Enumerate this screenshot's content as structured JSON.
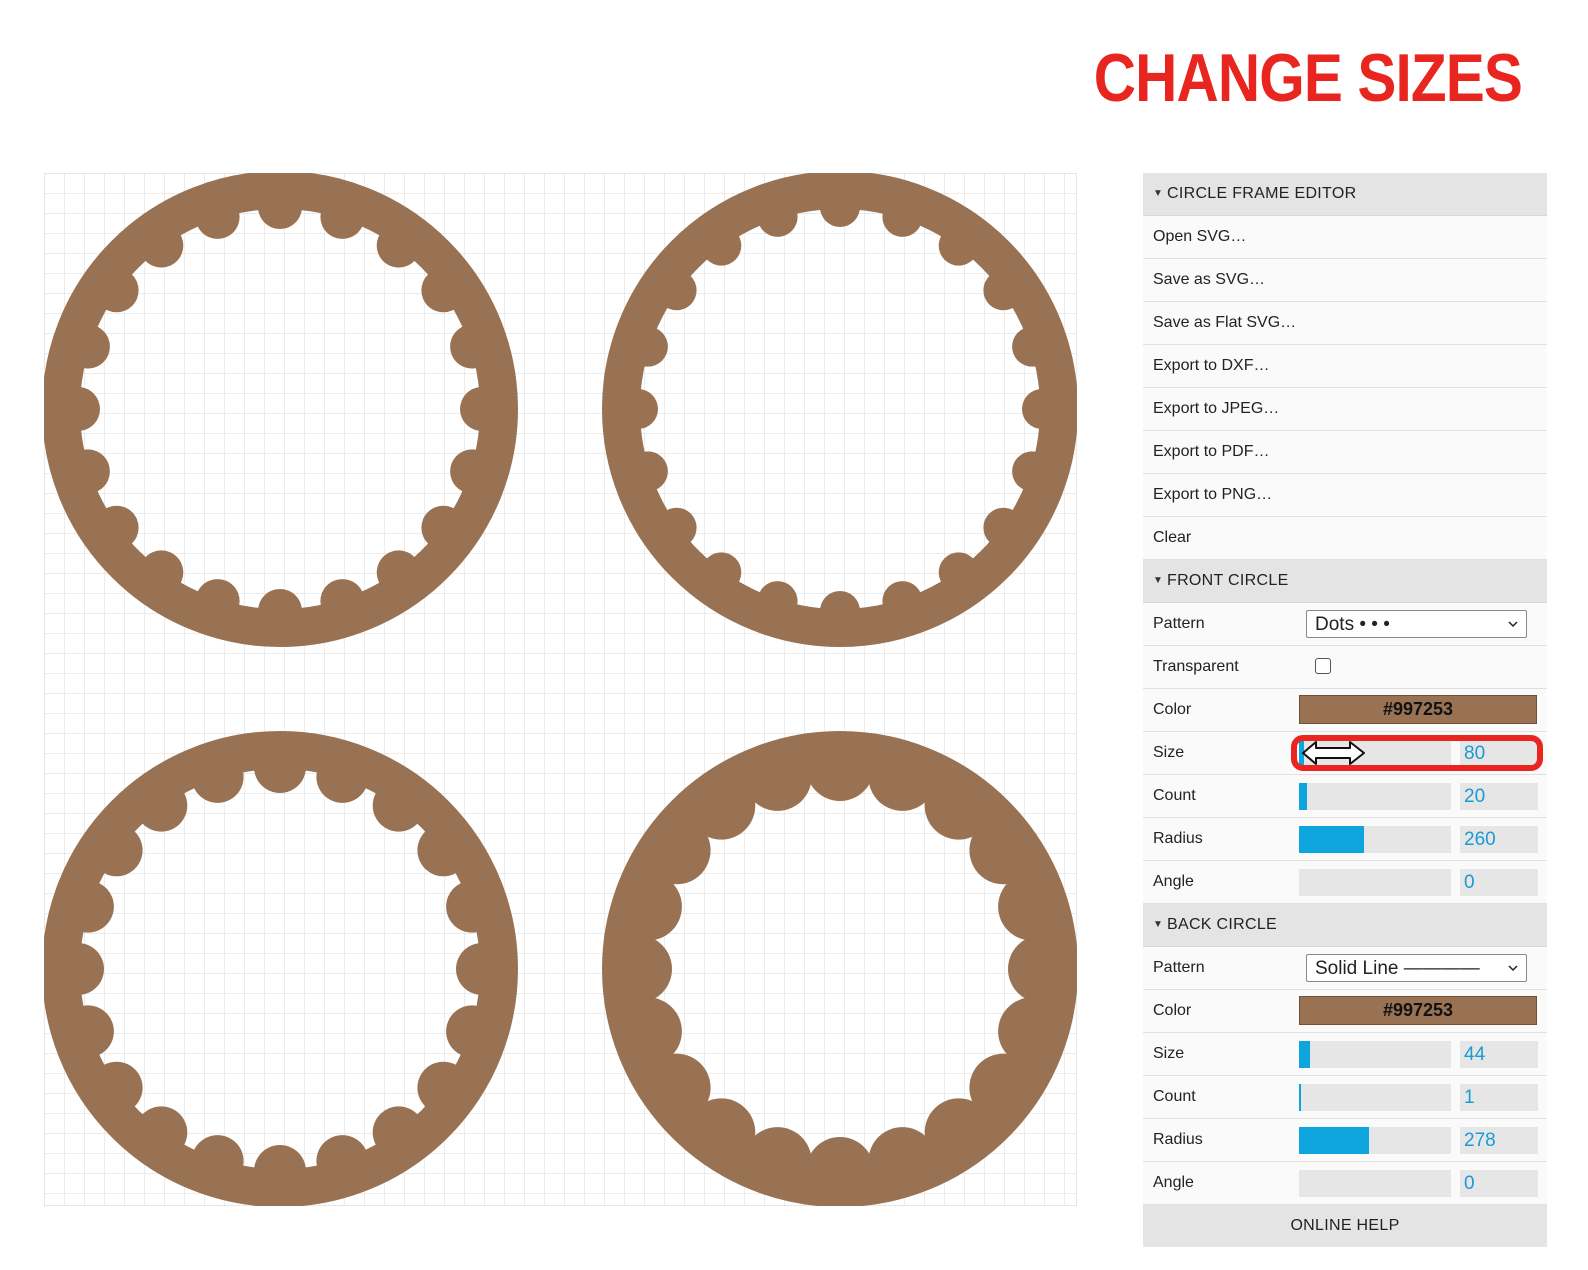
{
  "headline": "CHANGE SIZES",
  "colors": {
    "accent": "#e8251f",
    "frame": "#997253",
    "slider_fill": "#0ea5de",
    "value_text": "#1a9ad6"
  },
  "panel": {
    "editor": {
      "title": "CIRCLE FRAME EDITOR",
      "items": [
        "Open SVG…",
        "Save as SVG…",
        "Save as Flat SVG…",
        "Export to DXF…",
        "Export to JPEG…",
        "Export to PDF…",
        "Export to PNG…",
        "Clear"
      ]
    },
    "front": {
      "title": "FRONT CIRCLE",
      "pattern_label": "Pattern",
      "pattern_value": "Dots  •  •  •",
      "transparent_label": "Transparent",
      "color_label": "Color",
      "color_value": "#997253",
      "size_label": "Size",
      "size_value": "80",
      "size_fill": 0.03,
      "count_label": "Count",
      "count_value": "20",
      "count_fill": 0.05,
      "radius_label": "Radius",
      "radius_value": "260",
      "radius_fill": 0.43,
      "angle_label": "Angle",
      "angle_value": "0",
      "angle_fill": 0
    },
    "back": {
      "title": "BACK CIRCLE",
      "pattern_label": "Pattern",
      "pattern_value": "Solid Line  ————",
      "color_label": "Color",
      "color_value": "#997253",
      "size_label": "Size",
      "size_value": "44",
      "size_fill": 0.07,
      "count_label": "Count",
      "count_value": "1",
      "count_fill": 0.005,
      "radius_label": "Radius",
      "radius_value": "278",
      "radius_fill": 0.46,
      "angle_label": "Angle",
      "angle_value": "0",
      "angle_fill": 0
    },
    "help": "ONLINE HELP"
  }
}
